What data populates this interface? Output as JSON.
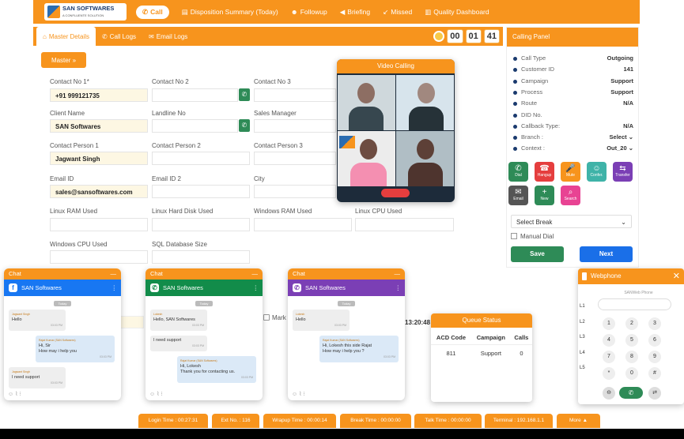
{
  "nav": {
    "logo_name": "SAN SOFTWARES",
    "logo_sub": "A CONFLUENTE SOLUTION",
    "call": "Call",
    "disposition": "Disposition Summary (Today)",
    "followup": "Followup",
    "briefing": "Briefing",
    "missed": "Missed",
    "quality": "Quality Dashboard"
  },
  "tabs": {
    "master": "Master Details",
    "call_logs": "Call Logs",
    "email_logs": "Email Logs"
  },
  "timer": {
    "h": "00",
    "m": "01",
    "s": "41"
  },
  "form": {
    "master_btn": "Master »",
    "contact1_label": "Contact No 1*",
    "contact1_value": "+91 999121735",
    "contact2_label": "Contact No 2",
    "contact3_label": "Contact No 3",
    "client_label": "Client Name",
    "client_value": "SAN Softwares",
    "landline_label": "Landline No",
    "sales_label": "Sales Manager",
    "person1_label": "Contact Person 1",
    "person1_value": "Jagwant Singh",
    "person2_label": "Contact Person 2",
    "person3_label": "Contact Person 3",
    "email1_label": "Email ID",
    "email1_value": "sales@sansoftwares.com",
    "email2_label": "Email ID 2",
    "city_label": "City",
    "linux_ram": "Linux RAM Used",
    "linux_disk": "Linux Hard Disk Used",
    "win_ram": "Windows RAM Used",
    "linux_cpu": "Linux CPU Used",
    "win_cpu": "Windows CPU Used",
    "sql_size": "SQL Database Size",
    "mark": "Mark",
    "time_value": "13:20:48"
  },
  "video": {
    "title": "Video Calling"
  },
  "calling_panel": {
    "title": "Calling Panel",
    "rows": [
      {
        "k": "Call Type",
        "v": "Outgoing"
      },
      {
        "k": "Customer ID",
        "v": "141"
      },
      {
        "k": "Campaign",
        "v": "Support"
      },
      {
        "k": "Process",
        "v": "Support"
      },
      {
        "k": "Route",
        "v": "N/A"
      },
      {
        "k": "DID No.",
        "v": ""
      },
      {
        "k": "Callback Type:",
        "v": "N/A"
      },
      {
        "k": "Branch :",
        "v": "Select ⌄"
      },
      {
        "k": "Context :",
        "v": "Out_20 ⌄"
      }
    ],
    "buttons": [
      "Dial",
      "Hangup",
      "Mute",
      "Confer.",
      "Transfer",
      "Email",
      "New",
      "Search"
    ],
    "select_break": "Select Break",
    "manual_dial": "Manual Dial",
    "save": "Save",
    "next": "Next"
  },
  "chats": [
    {
      "top": "Chat",
      "name": "SAN Softwares",
      "today": "Today",
      "msgs": [
        {
          "dir": "in",
          "from": "Jagwant Singh",
          "text": "Hello",
          "time": "03:03 PM"
        },
        {
          "dir": "out",
          "from": "Rajat Kumar (SAN Softwares)",
          "text": "Hi, Sir\nHow may i help you",
          "time": "03:03 PM"
        },
        {
          "dir": "in",
          "from": "Jagwant Singh",
          "text": "I need support",
          "time": "03:03 PM"
        }
      ]
    },
    {
      "top": "Chat",
      "name": "SAN Softwares",
      "today": "Today",
      "msgs": [
        {
          "dir": "in",
          "from": "Lokesh",
          "text": "Hello, SAN Softwares",
          "time": "03:03 PM"
        },
        {
          "dir": "in",
          "from": "",
          "text": "I need support",
          "time": "03:03 PM"
        },
        {
          "dir": "out",
          "from": "Rajat Kumar (SAN Softwares)",
          "text": "Hi, Lokesh\nThank you for contacting us.",
          "time": "03:03 PM"
        }
      ]
    },
    {
      "top": "Chat",
      "name": "SAN Softwares",
      "today": "Today",
      "msgs": [
        {
          "dir": "in",
          "from": "Lokesh",
          "text": "Hello",
          "time": "03:03 PM"
        },
        {
          "dir": "out",
          "from": "Rajat Kumar (SAN Softwares)",
          "text": "Hi, Lokesh this side Rajat\nHow may i help you ?",
          "time": "03:03 PM"
        }
      ]
    }
  ],
  "queue": {
    "title": "Queue Status",
    "headers": [
      "ACD Code",
      "Campaign",
      "Calls"
    ],
    "rows": [
      [
        "811",
        "Support",
        "0"
      ]
    ]
  },
  "webphone": {
    "title": "Webphone",
    "subtitle": "SANWeb Phone",
    "lines": [
      "L1",
      "L2",
      "L3",
      "L4",
      "L5"
    ],
    "keys": [
      "1",
      "2",
      "3",
      "4",
      "5",
      "6",
      "7",
      "8",
      "9",
      "*",
      "0",
      "#"
    ]
  },
  "stats": {
    "login": "Login Time : 00:27:31",
    "ext": "Ext No. : 116",
    "wrapup": "Wrapup Time : 00:00:14",
    "break": "Break Time : 00:00:00",
    "talk": "Talk Time : 00:00:00",
    "terminal": "Terminal : 192.168.1.1",
    "more": "More ▲"
  },
  "colors": {
    "accent": "#f7941d",
    "green": "#2e8b57",
    "blue": "#1a6fe8",
    "facebook": "#1877f2",
    "whatsapp": "#128c4a",
    "viber": "#7b3fb5"
  }
}
